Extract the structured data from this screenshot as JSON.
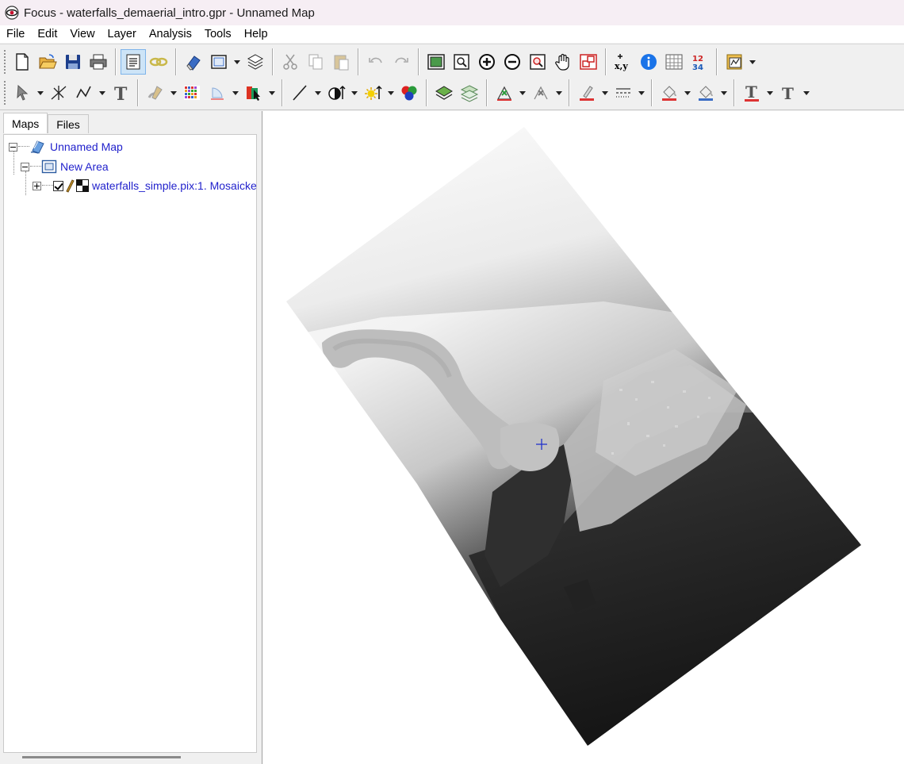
{
  "window": {
    "title": "Focus - waterfalls_demaerial_intro.gpr - Unnamed Map",
    "app_icon": "eye-icon"
  },
  "menu": [
    "File",
    "Edit",
    "View",
    "Layer",
    "Analysis",
    "Tools",
    "Help"
  ],
  "toolbar": {
    "row1_icons": [
      "new-file-icon",
      "open-folder-icon",
      "save-icon",
      "print-icon",
      "map-properties-icon",
      "link-icon",
      "eraser-icon",
      "area-icon",
      "layers-icon",
      "cut-icon",
      "copy-icon",
      "paste-icon",
      "undo-icon",
      "redo-icon",
      "zoom-to-extent-icon",
      "zoom-to-layer-icon",
      "zoom-in-icon",
      "zoom-out-icon",
      "zoom-to-selection-icon",
      "pan-hand-icon",
      "overview-icon",
      "coordinates-icon",
      "info-icon",
      "table-icon",
      "numbers-icon",
      "chart-icon"
    ],
    "coordinates_label": "x,y",
    "numbers_label_top": "12",
    "numbers_label_bottom": "34",
    "row2_icons": [
      "select-arrow-icon",
      "edit-vertex-icon",
      "polyline-icon",
      "text-tool-icon",
      "style-icon",
      "raster-grid-icon",
      "fill-icon",
      "color-picker-icon",
      "line-icon",
      "contrast-icon",
      "brightness-icon",
      "rgb-icon",
      "layer-stack-icon",
      "layer-stack-green-icon",
      "vertex-tool-icon",
      "cross-tool-icon",
      "pen-color-icon",
      "line-style-icon",
      "fill-color-icon",
      "paint-bucket-icon",
      "font-color-icon",
      "font-style-icon"
    ],
    "text_glyph": "T"
  },
  "left_panel": {
    "tabs": [
      "Maps",
      "Files"
    ],
    "active_tab": "Maps",
    "tree": {
      "map_label": "Unnamed Map",
      "area_label": "New Area",
      "layer_label": "waterfalls_simple.pix:1. Mosaicke"
    }
  },
  "colors": {
    "link": "#2222cc",
    "crosshair": "#2233cc",
    "titlebar_bg": "#f6eef4"
  }
}
